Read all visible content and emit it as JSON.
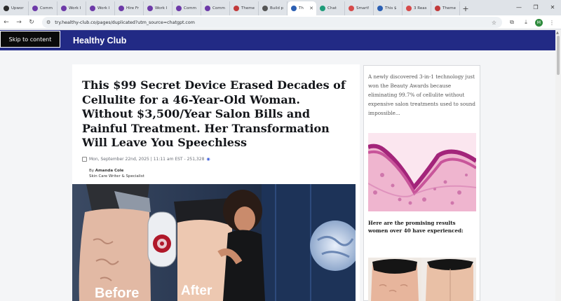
{
  "browser": {
    "tabs": [
      {
        "label": "Upwor",
        "fav": "#2c2c2c"
      },
      {
        "label": "Comm",
        "fav": "#6d3aa8"
      },
      {
        "label": "Work I",
        "fav": "#6d3aa8"
      },
      {
        "label": "Work I",
        "fav": "#6d3aa8"
      },
      {
        "label": "Hire Fr",
        "fav": "#6d3aa8"
      },
      {
        "label": "Work I",
        "fav": "#6d3aa8"
      },
      {
        "label": "Comm",
        "fav": "#6d3aa8"
      },
      {
        "label": "Comm",
        "fav": "#6d3aa8"
      },
      {
        "label": "Theme",
        "fav": "#c23a3a"
      },
      {
        "label": "Build p",
        "fav": "#555555"
      },
      {
        "label": "Th",
        "fav": "#2b5fb3"
      },
      {
        "label": "Chat",
        "fav": "#1f9c7a"
      },
      {
        "label": "Smart!",
        "fav": "#d64a4a"
      },
      {
        "label": "This $",
        "fav": "#2b5fb3"
      },
      {
        "label": "3 Reas",
        "fav": "#d64a4a"
      },
      {
        "label": "Theme",
        "fav": "#c23a3a"
      }
    ],
    "active_tab_index": 10,
    "url": "try.healthy-club.co/pages/duplicated?utm_source=chatgpt.com",
    "profile_initial": "M"
  },
  "site": {
    "skip_link": "Skip to content",
    "brand": "Healthy Club",
    "header_color": "#222a85"
  },
  "article": {
    "headline": "This $99 Secret Device Erased Decades of Cellulite for a 46-Year-Old Woman. Without $3,500/Year Salon Bills and Painful Treatment. Her Transformation Will Leave You Speechless",
    "meta_date": "Mon, September 22nd, 2025 | 11:11 am EST - 251,328",
    "meta_views_icon": "eye-icon",
    "author_prefix": "By",
    "author_name": "Amanda Cole",
    "author_role": "Skin Care Writer & Specialist",
    "hero_before": "Before",
    "hero_after": "After"
  },
  "sidebar": {
    "intro": "A newly discovered 3-in-1 technology just won the Beauty Awards because eliminating 99.7% of cellulite without expensive salon treatments used to sound impossible...",
    "results_heading": "Here are the promising results women over 40 have experienced:"
  }
}
